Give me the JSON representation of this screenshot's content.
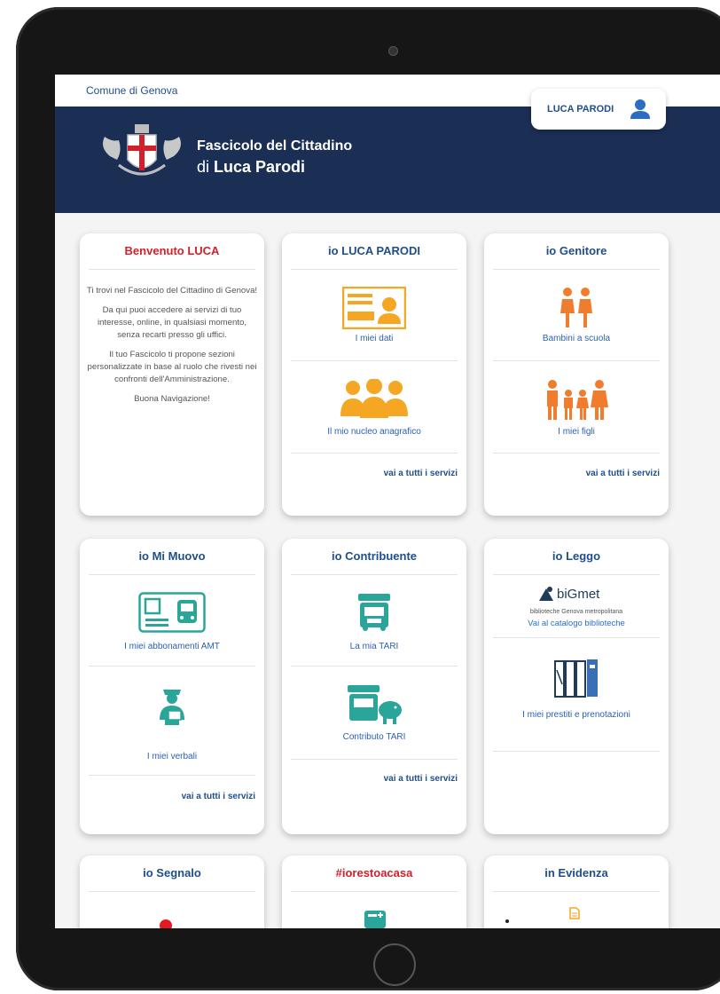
{
  "topbar": {
    "comune": "Comune di Genova"
  },
  "header": {
    "title": "Fascicolo del Cittadino",
    "subtitle_prefix": "di",
    "subtitle_name": "Luca Parodi"
  },
  "user": {
    "name": "LUCA PARODI"
  },
  "welcome_card": {
    "title": "Benvenuto LUCA",
    "paragraphs": [
      "Ti trovi nel Fascicolo del Cittadino di Genova!",
      "Da qui puoi accedere ai servizi di tuo interesse, online, in qualsiasi momento, senza recarti presso gli uffici.",
      "Il tuo Fascicolo ti propone sezioni personalizzate in base al ruolo che rivesti nei confronti dell'Amministrazione.",
      "Buona Navigazione!"
    ]
  },
  "cards": {
    "io_luca": {
      "title": "io LUCA PARODI",
      "items": [
        "I miei dati",
        "Il mio nucleo anagrafico"
      ],
      "more": "vai a tutti i servizi"
    },
    "io_genitore": {
      "title": "io Genitore",
      "items": [
        "Bambini a scuola",
        "I miei figli"
      ],
      "more": "vai a tutti i servizi"
    },
    "io_mi_muovo": {
      "title": "io Mi Muovo",
      "items": [
        "I miei abbonamenti AMT",
        "I miei verbali"
      ],
      "more": "vai a tutti i servizi"
    },
    "io_contribuente": {
      "title": "io Contribuente",
      "items": [
        "La mia TARI",
        "Contributo TARI"
      ],
      "more": "vai a tutti i servizi"
    },
    "io_leggo": {
      "title": "io Leggo",
      "logo_text": "biGmet",
      "logo_subtitle": "biblioteche Genova metropolitana",
      "items": [
        "Vai al catalogo biblioteche",
        "I miei prestiti e prenotazioni"
      ]
    },
    "io_segnalo": {
      "title": "io Segnalo"
    },
    "iorestoacasa": {
      "title": "#iorestoacasa"
    },
    "in_evidenza": {
      "title": "in Evidenza"
    }
  },
  "colors": {
    "header": "#1b2f55",
    "link": "#1f4e8c",
    "accent_red": "#d31f2a",
    "orange": "#f5a623",
    "teal": "#2aa59a"
  }
}
